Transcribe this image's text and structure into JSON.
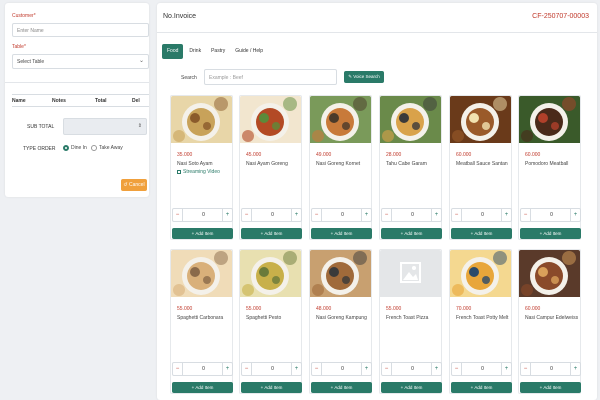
{
  "form": {
    "customer_label": "Customer",
    "required_mark": "*",
    "customer_placeholder": "Enter Name",
    "table_label": "Table",
    "table_selected": "Select Table"
  },
  "order_table": {
    "headers": [
      "Name",
      "Notes",
      "Total",
      "Del"
    ]
  },
  "subtotal": {
    "label": "SUB TOTAL",
    "spin_glyph": "⇕"
  },
  "type_order": {
    "label": "TYPE ORDER",
    "options": [
      "Dine In",
      "Take Away"
    ],
    "selected": "Dine In"
  },
  "cancel_label": "Cancel",
  "header": {
    "title": "No.Invoice",
    "invoice_number": "CF-250707-00003"
  },
  "tabs": [
    "Food",
    "Drink",
    "Pastry",
    "Guide / Help"
  ],
  "active_tab": "Food",
  "search": {
    "label": "Search",
    "placeholder": "Example : Beef",
    "voice_button": "Voice Search"
  },
  "add_item_label": "Add Item",
  "products": [
    {
      "price": "35.000",
      "name": "Nasi Soto Ayam",
      "video": "Streaming Video",
      "qty": "0",
      "colors": [
        "#c8a25a",
        "#8a5a2b",
        "#e8d6a8"
      ]
    },
    {
      "price": "45.000",
      "name": "Nasi Ayam Goreng",
      "video": "",
      "qty": "0",
      "colors": [
        "#b34a25",
        "#5c8a3a",
        "#f2e6cf"
      ]
    },
    {
      "price": "49.000",
      "name": "Nasi Goreng Kornet",
      "video": "",
      "qty": "0",
      "colors": [
        "#c87a3a",
        "#4a3a2a",
        "#7a9a5a"
      ]
    },
    {
      "price": "28.000",
      "name": "Tahu Cabe Garam",
      "video": "",
      "qty": "0",
      "colors": [
        "#d9a24a",
        "#3a3a3a",
        "#6a8a4a"
      ]
    },
    {
      "price": "60.000",
      "name": "Meatball Sauce Santan",
      "video": "",
      "qty": "0",
      "colors": [
        "#9a5a2a",
        "#f2e2b0",
        "#6a3a1a"
      ]
    },
    {
      "price": "60.000",
      "name": "Pomodoro Meatball",
      "video": "",
      "qty": "0",
      "colors": [
        "#4a2a1a",
        "#b0402a",
        "#3a5a2a"
      ]
    },
    {
      "price": "55.000",
      "name": "Spaghetti Carbonara",
      "video": "",
      "qty": "0",
      "colors": [
        "#d9b07a",
        "#8a6a4a",
        "#f0dcb8"
      ]
    },
    {
      "price": "55.000",
      "name": "Spaghetti Pesto",
      "video": "",
      "qty": "0",
      "colors": [
        "#c8b04a",
        "#6a7a3a",
        "#e8e0b0"
      ]
    },
    {
      "price": "48.000",
      "name": "Nasi Goreng Kampung",
      "video": "",
      "qty": "0",
      "colors": [
        "#a06a3a",
        "#3a3a3a",
        "#c8a070"
      ]
    },
    {
      "price": "55.000",
      "name": "French Toast Pizza",
      "video": "",
      "qty": "0",
      "placeholder": true,
      "colors": [
        "#e4e6e8",
        "#c8ccd0",
        "#ffffff"
      ]
    },
    {
      "price": "70.000",
      "name": "French Toast Potty Melt",
      "video": "",
      "qty": "0",
      "colors": [
        "#e8a63a",
        "#2a4a6a",
        "#f4d890"
      ]
    },
    {
      "price": "60.000",
      "name": "Nasi Campur Edelweiss",
      "video": "",
      "qty": "0",
      "colors": [
        "#8a4a2a",
        "#d9a05a",
        "#5a3a2a"
      ]
    }
  ]
}
